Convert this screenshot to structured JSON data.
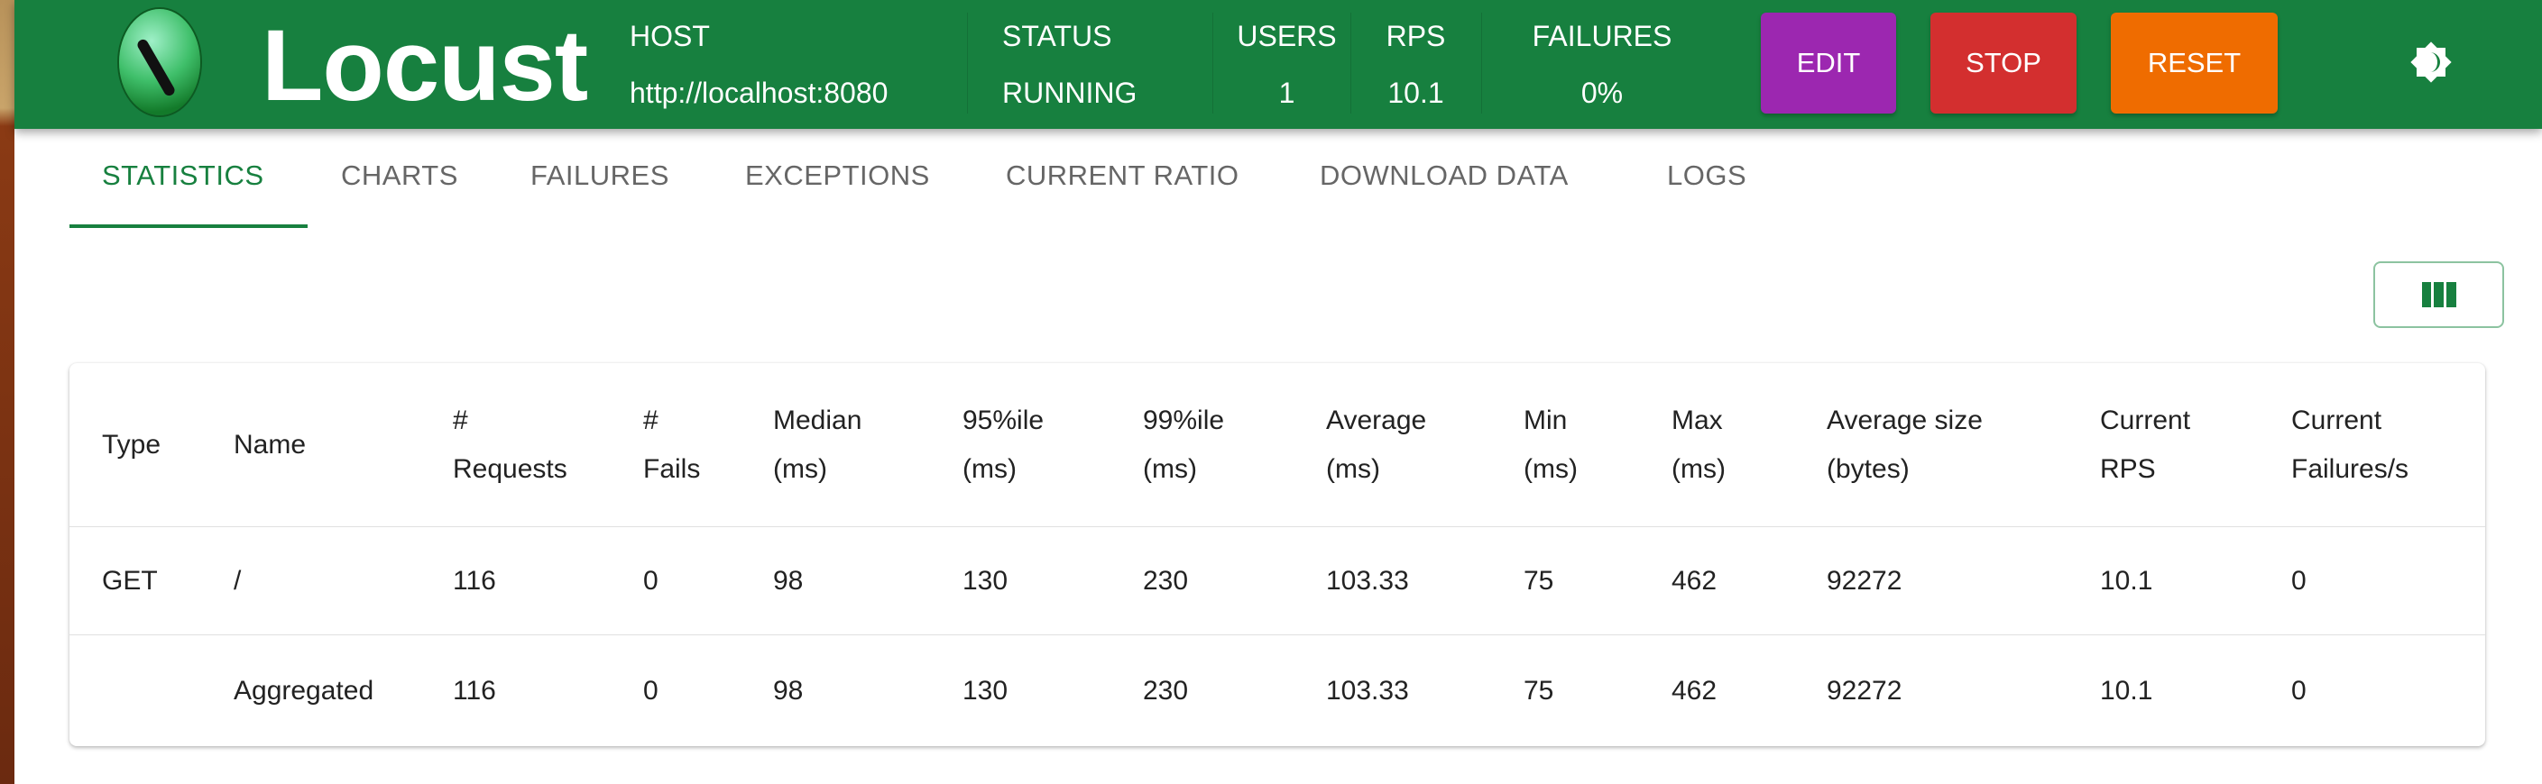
{
  "header": {
    "brand": "Locust",
    "stats": [
      {
        "label": "HOST",
        "value": "http://localhost:8080"
      },
      {
        "label": "STATUS",
        "value": "RUNNING"
      },
      {
        "label": "USERS",
        "value": "1"
      },
      {
        "label": "RPS",
        "value": "10.1"
      },
      {
        "label": "FAILURES",
        "value": "0%"
      }
    ],
    "buttons": {
      "edit": "EDIT",
      "stop": "STOP",
      "reset": "RESET"
    },
    "colors": {
      "brand": "#17803f",
      "edit": "#9c27b0",
      "stop": "#d32f2f",
      "reset": "#ef6c00"
    }
  },
  "tabs": [
    "STATISTICS",
    "CHARTS",
    "FAILURES",
    "EXCEPTIONS",
    "CURRENT RATIO",
    "DOWNLOAD DATA",
    "LOGS"
  ],
  "table": {
    "headers": [
      "Type",
      "Name",
      "#\nRequests",
      "#\nFails",
      "Median\n(ms)",
      "95%ile\n(ms)",
      "99%ile\n(ms)",
      "Average\n(ms)",
      "Min\n(ms)",
      "Max\n(ms)",
      "Average size\n(bytes)",
      "Current\nRPS",
      "Current\nFailures/s"
    ],
    "rows": [
      [
        "GET",
        "/",
        "116",
        "0",
        "98",
        "130",
        "230",
        "103.33",
        "75",
        "462",
        "92272",
        "10.1",
        "0"
      ],
      [
        "",
        "Aggregated",
        "116",
        "0",
        "98",
        "130",
        "230",
        "103.33",
        "75",
        "462",
        "92272",
        "10.1",
        "0"
      ]
    ]
  }
}
